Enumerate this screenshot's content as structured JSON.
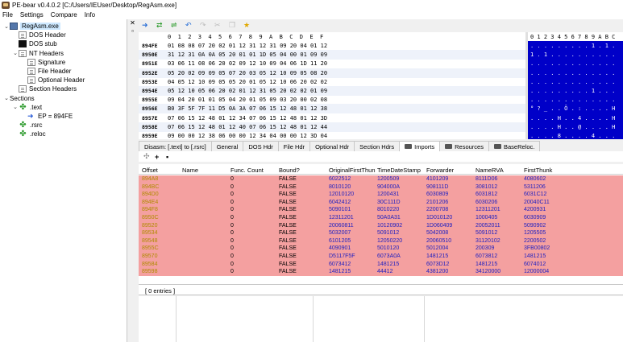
{
  "window": {
    "title": "PE-bear v0.4.0.2 [C:/Users/IEUser/Desktop/RegAsm.exe]"
  },
  "menu": [
    "File",
    "Settings",
    "Compare",
    "Info"
  ],
  "tree": [
    {
      "label": "RegAsm.exe",
      "icon": "exe-icon",
      "level": 0,
      "expander": "⌄",
      "selected": true
    },
    {
      "label": "DOS Header",
      "icon": "document-icon",
      "level": 1,
      "expander": ""
    },
    {
      "label": "DOS stub",
      "icon": "block-icon",
      "level": 1,
      "expander": ""
    },
    {
      "label": "NT Headers",
      "icon": "document-icon",
      "level": 1,
      "expander": "⌄"
    },
    {
      "label": "Signature",
      "icon": "document-icon",
      "level": 2,
      "expander": ""
    },
    {
      "label": "File Header",
      "icon": "document-icon",
      "level": 2,
      "expander": ""
    },
    {
      "label": "Optional Header",
      "icon": "document-icon",
      "level": 2,
      "expander": ""
    },
    {
      "label": "Section Headers",
      "icon": "document-icon",
      "level": 1,
      "expander": ""
    },
    {
      "label": "Sections",
      "icon": "",
      "level": 0,
      "expander": "⌄"
    },
    {
      "label": ".text",
      "icon": "puzzle-icon",
      "level": 1,
      "expander": "⌄"
    },
    {
      "label": "EP = 894FE",
      "icon": "arrow-right-icon",
      "level": 2,
      "expander": ""
    },
    {
      "label": ".rsrc",
      "icon": "puzzle-icon",
      "level": 1,
      "expander": ""
    },
    {
      "label": ".reloc",
      "icon": "puzzle-icon",
      "level": 1,
      "expander": ""
    }
  ],
  "hex": {
    "columns": [
      "0",
      "1",
      "2",
      "3",
      "4",
      "5",
      "6",
      "7",
      "8",
      "9",
      "A",
      "B",
      "C",
      "D",
      "E",
      "F"
    ],
    "rows": [
      {
        "offset": "894FE",
        "bytes": "01 08 08 07 20 02 01 12 31 12 31 09 20 04 01 12"
      },
      {
        "offset": "8950E",
        "bytes": "31 12 31 0A 0A 05 20 01 01 1D 05 04 00 01 09 09"
      },
      {
        "offset": "8951E",
        "bytes": "03 06 11 08 06 20 02 09 12 10 09 04 06 1D 11 20"
      },
      {
        "offset": "8952E",
        "bytes": "05 20 02 09 09 05 07 20 03 05 12 10 09 05 08 20"
      },
      {
        "offset": "8953E",
        "bytes": "04 05 12 10 09 05 05 20 01 05 12 10 06 20 02 02"
      },
      {
        "offset": "8954E",
        "bytes": "05 12 10 05 06 20 02 01 12 31 05 20 02 02 01 09"
      },
      {
        "offset": "8955E",
        "bytes": "09 04 20 01 01 05 04 20 01 05 09 03 20 00 02 08"
      },
      {
        "offset": "8956E",
        "bytes": "B0 3F 5F 7F 11 D5 0A 3A 07 06 15 12 48 01 12 38"
      },
      {
        "offset": "8957E",
        "bytes": "07 06 15 12 48 01 12 34 07 06 15 12 48 01 12 3D"
      },
      {
        "offset": "8958E",
        "bytes": "07 06 15 12 48 01 12 40 07 06 15 12 48 01 12 44"
      },
      {
        "offset": "8959E",
        "bytes": "09 00 00 12 38 06 00 00 12 34 04 00 00 12 3D 04"
      }
    ]
  },
  "ascii": {
    "header": "0 1 2 3 4 5 6 7 8 9 A B C",
    "rows": [
      ". . . . . . . . . 1 . 1 .",
      "1 . 1 . . . . . . . . . .",
      ". . . . . . . . . . . . .",
      ". . . . . . . . . . . . .",
      ". . . . . . . . . . . . .",
      ". . . . . . . . . 1 . . .",
      ". . . . . . . . . . . . .",
      "° ? _ . . Õ . : . . . . H",
      ". . . . H . . 4 . . . . H",
      ". . . . H . . @ . . . . H",
      ". . . . 8 . . . . 4 . . ."
    ]
  },
  "tabs": [
    {
      "label": "Disasm: [.text] to [.rsrc]"
    },
    {
      "label": "General"
    },
    {
      "label": "DOS Hdr"
    },
    {
      "label": "File Hdr"
    },
    {
      "label": "Optional Hdr"
    },
    {
      "label": "Section Hdrs"
    },
    {
      "label": "Imports",
      "active": true,
      "folder": true
    },
    {
      "label": "Resources",
      "folder": true
    },
    {
      "label": "BaseReloc.",
      "folder": true
    }
  ],
  "imports": {
    "columns": [
      "Offset",
      "Name",
      "Func. Count",
      "Bound?",
      "OriginalFirstThun",
      "TimeDateStamp",
      "Forwarder",
      "NameRVA",
      "FirstThunk"
    ],
    "rows": [
      [
        "894A8",
        "",
        "0",
        "FALSE",
        "6022512",
        "1200509",
        "4101209",
        "8111D06",
        "4080602"
      ],
      [
        "894BC",
        "",
        "0",
        "FALSE",
        "8010120",
        "904000A",
        "908111D",
        "3081012",
        "5311206"
      ],
      [
        "894D0",
        "",
        "0",
        "FALSE",
        "12010120",
        "1200431",
        "6030809",
        "6031812",
        "6031C12"
      ],
      [
        "894E4",
        "",
        "0",
        "FALSE",
        "6042412",
        "30C111D",
        "2101206",
        "6030206",
        "20040C11"
      ],
      [
        "894F8",
        "",
        "0",
        "FALSE",
        "5090101",
        "8010220",
        "2200708",
        "12311201",
        "4200931"
      ],
      [
        "8950C",
        "",
        "0",
        "FALSE",
        "12311201",
        "50A0A31",
        "1D010120",
        "1000405",
        "6030909"
      ],
      [
        "89520",
        "",
        "0",
        "FALSE",
        "20060811",
        "10120902",
        "1D060409",
        "20052011",
        "5090902"
      ],
      [
        "89534",
        "",
        "0",
        "FALSE",
        "5032007",
        "5091012",
        "5042008",
        "5091012",
        "1205505"
      ],
      [
        "89548",
        "",
        "0",
        "FALSE",
        "6101205",
        "12050220",
        "20060510",
        "31120102",
        "2200502"
      ],
      [
        "8955C",
        "",
        "0",
        "FALSE",
        "4090901",
        "5010120",
        "5012004",
        "200309",
        "3FB00802"
      ],
      [
        "89570",
        "",
        "0",
        "FALSE",
        "D5117F5F",
        "6073A0A",
        "1481215",
        "6073812",
        "1481215"
      ],
      [
        "89584",
        "",
        "0",
        "FALSE",
        "6073412",
        "1481215",
        "6073D12",
        "1481215",
        "6074012"
      ],
      [
        "89598",
        "",
        "0",
        "FALSE",
        "1481215",
        "44412",
        "4381200",
        "34120000",
        "12000004"
      ]
    ]
  },
  "entries_text": "[ 0 entries ]"
}
